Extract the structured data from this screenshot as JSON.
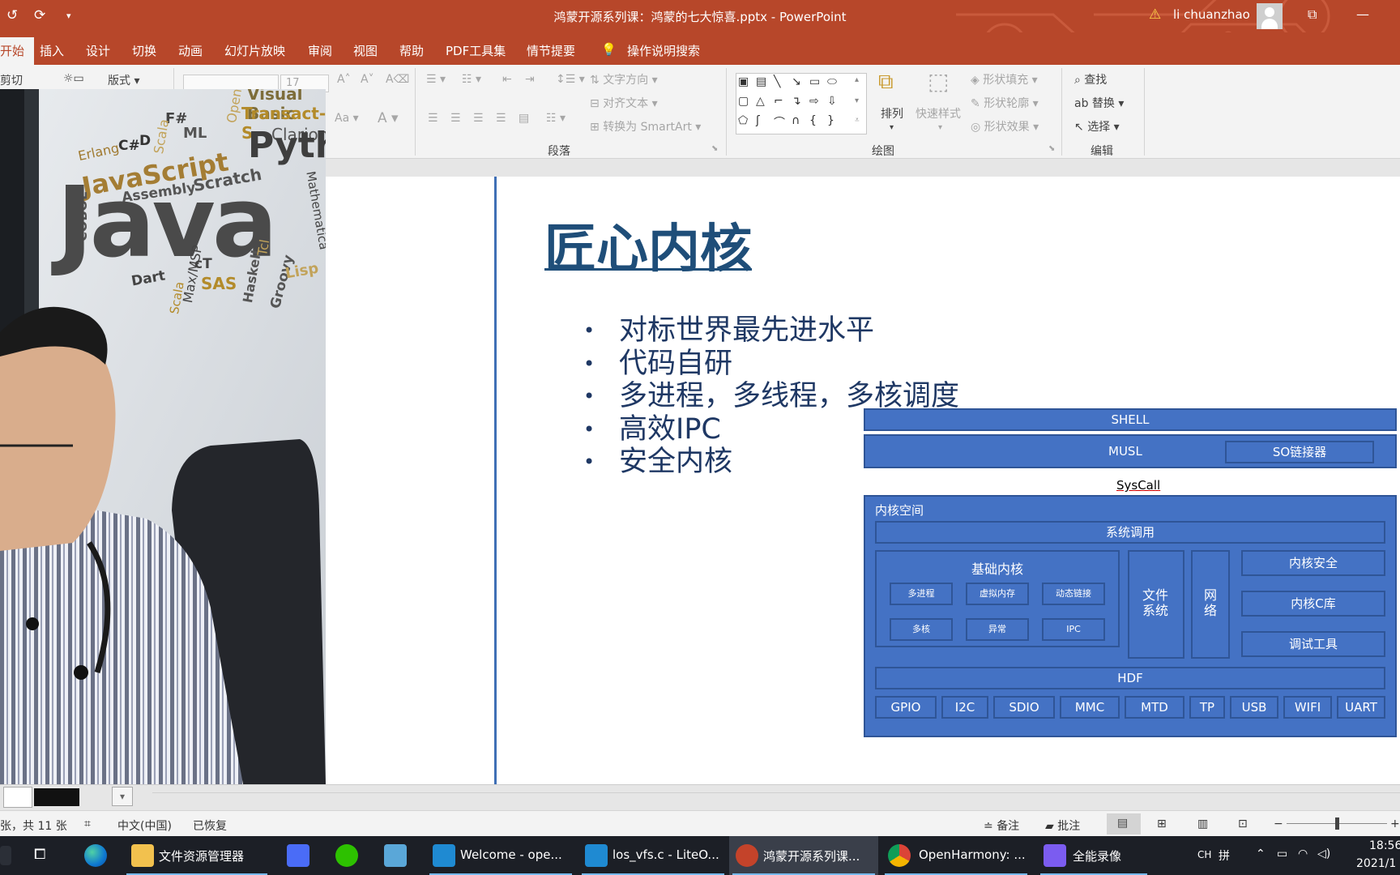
{
  "titlebar": {
    "document_title": "鸿蒙开源系列课：鸿蒙的七大惊喜.pptx  -  PowerPoint",
    "user": "li chuanzhao",
    "quick_access": [
      "↺",
      "⟳",
      "▾"
    ],
    "controls": [
      "⧉",
      "—"
    ]
  },
  "tabs": [
    "开始",
    "插入",
    "设计",
    "切换",
    "动画",
    "幻灯片放映",
    "审阅",
    "视图",
    "帮助",
    "PDF工具集",
    "情节提要"
  ],
  "tell_me": "操作说明搜索",
  "ribbon": {
    "clipboard": {
      "cut": "剪切",
      "layout": "版式"
    },
    "font": {
      "size_value": "17"
    },
    "paragraph": {
      "text_direction": "文字方向",
      "align_text": "对齐文本",
      "convert_smartart": "转换为 SmartArt",
      "group_label": "段落"
    },
    "drawing": {
      "arrange": "排列",
      "quick_styles": "快速样式",
      "shape_fill": "形状填充",
      "shape_outline": "形状轮廓",
      "shape_effects": "形状效果",
      "group_label": "绘图"
    },
    "editing": {
      "find": "查找",
      "replace": "替换",
      "select": "选择",
      "group_label": "编辑"
    }
  },
  "slide": {
    "title": "匠心内核",
    "bullets": [
      "对标世界最先进水平",
      "代码自研",
      "多进程，多线程，多核调度",
      "高效IPC",
      "安全内核"
    ],
    "diagram": {
      "shell": "SHELL",
      "musl": "MUSL",
      "so_linker": "SO链接器",
      "syscall": "SysCall",
      "kernel_space": "内核空间",
      "system_call": "系统调用",
      "base_kernel": "基础内核",
      "base_items": [
        "多进程",
        "虚拟内存",
        "动态链接",
        "多核",
        "异常",
        "IPC"
      ],
      "filesystem": "文件系统",
      "network": "网络",
      "kernel_security": "内核安全",
      "kernel_clib": "内核C库",
      "debug_tools": "调试工具",
      "hdf": "HDF",
      "drivers": [
        "GPIO",
        "I2C",
        "SDIO",
        "MMC",
        "MTD",
        "TP",
        "USB",
        "WIFI",
        "UART"
      ]
    }
  },
  "webcam": {
    "words": [
      "Visual Basic",
      "Transact-S",
      "Clarion",
      "OpenEdge",
      "F#",
      "ML",
      "Scala",
      "Erlang",
      "C#",
      "D",
      "JavaScript",
      "Pytho",
      "Assembly",
      "Scratch",
      "COBOL",
      "Java",
      "Dart",
      "cT",
      "Max/MSP",
      "Scala",
      "SAS",
      "Haskell",
      "Tcl",
      "Groovy",
      "Lisp",
      "Mathematica"
    ]
  },
  "statusbar": {
    "slide_count": "张，共 11 张",
    "language": "中文(中国)",
    "recovered": "已恢复",
    "notes": "备注",
    "comments": "批注"
  },
  "taskbar": {
    "apps": [
      "文件资源管理器",
      "Welcome - ope...",
      "los_vfs.c - LiteO...",
      "鸿蒙开源系列课...",
      "OpenHarmony: ...",
      "全能录像"
    ],
    "ime": "CH",
    "ime2": "拼",
    "time": "18:56",
    "date": "2021/1"
  },
  "colors": {
    "accent": "#b7472a",
    "diagram_fill": "#4472c4",
    "diagram_border": "#2f5597",
    "slide_title": "#1f4e79"
  }
}
